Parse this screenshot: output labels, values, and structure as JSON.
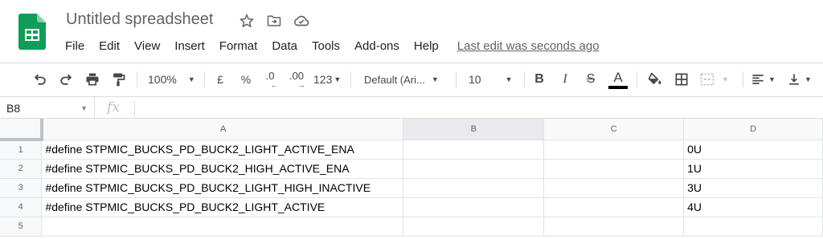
{
  "doc": {
    "title": "Untitled spreadsheet",
    "last_edit": "Last edit was seconds ago"
  },
  "menu": [
    "File",
    "Edit",
    "View",
    "Insert",
    "Format",
    "Data",
    "Tools",
    "Add-ons",
    "Help"
  ],
  "toolbar": {
    "zoom": "100%",
    "currency": "£",
    "percent": "%",
    "decrease_decimals": ".0",
    "increase_decimals": ".00",
    "more_formats": "123",
    "font": "Default (Ari...",
    "font_size": "10",
    "bold": "B",
    "italic": "I",
    "strikethrough": "S",
    "text_color_letter": "A"
  },
  "formula_bar": {
    "cell_ref": "B8",
    "fx": "fx"
  },
  "colors": {
    "sheets_green": "#0F9D58",
    "text_color_swatch": "#000000"
  },
  "grid": {
    "columns": [
      "A",
      "B",
      "C",
      "D"
    ],
    "rows": [
      {
        "num": "1",
        "cells": [
          "#define STPMIC_BUCKS_PD_BUCK2_LIGHT_ACTIVE_ENA",
          "",
          "",
          "0U"
        ]
      },
      {
        "num": "2",
        "cells": [
          "#define STPMIC_BUCKS_PD_BUCK2_HIGH_ACTIVE_ENA",
          "",
          "",
          "1U"
        ]
      },
      {
        "num": "3",
        "cells": [
          "#define STPMIC_BUCKS_PD_BUCK2_LIGHT_HIGH_INACTIVE",
          "",
          "",
          "3U"
        ]
      },
      {
        "num": "4",
        "cells": [
          "#define STPMIC_BUCKS_PD_BUCK2_LIGHT_ACTIVE",
          "",
          "",
          "4U"
        ]
      },
      {
        "num": "5",
        "cells": [
          "",
          "",
          "",
          ""
        ]
      }
    ]
  }
}
